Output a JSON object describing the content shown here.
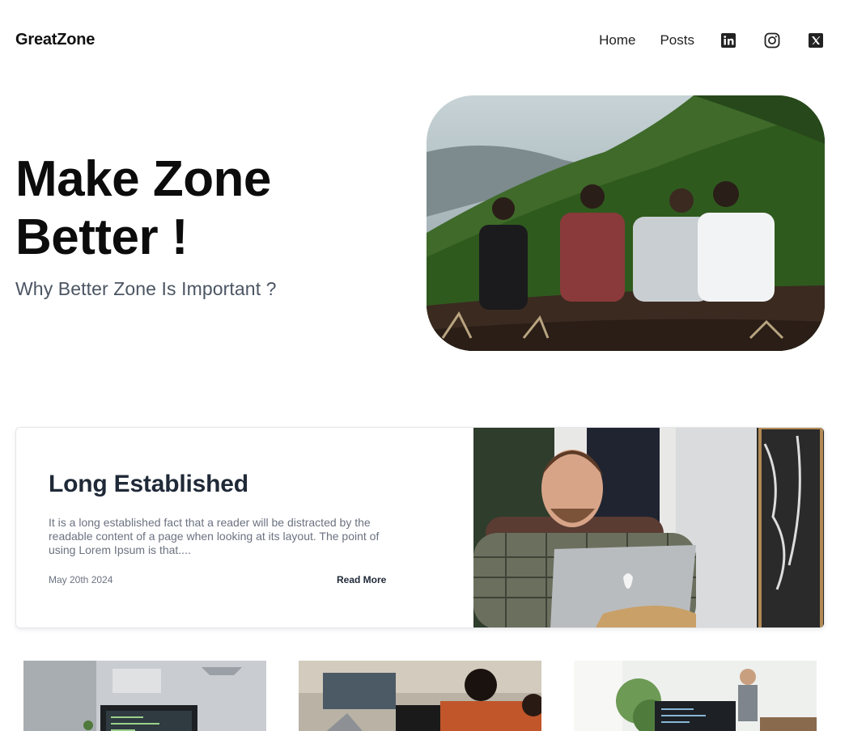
{
  "header": {
    "brand": "GreatZone",
    "nav": [
      {
        "label": "Home"
      },
      {
        "label": "Posts"
      }
    ],
    "social": [
      "linkedin-icon",
      "instagram-icon",
      "x-twitter-icon"
    ]
  },
  "hero": {
    "title": "Make Zone Better !",
    "subtitle": "Why Better Zone Is Important ?"
  },
  "featured": {
    "title": "Long Established",
    "excerpt": "It is a long established fact that a reader will be distracted by the readable content of a page when looking at its layout. The point of using Lorem Ipsum is that....",
    "date": "May 20th 2024",
    "read_more": "Read More"
  },
  "colors": {
    "text": "#111111",
    "muted": "#6b7280",
    "subtitle": "#4b5563",
    "card_border": "#e5e7eb"
  }
}
